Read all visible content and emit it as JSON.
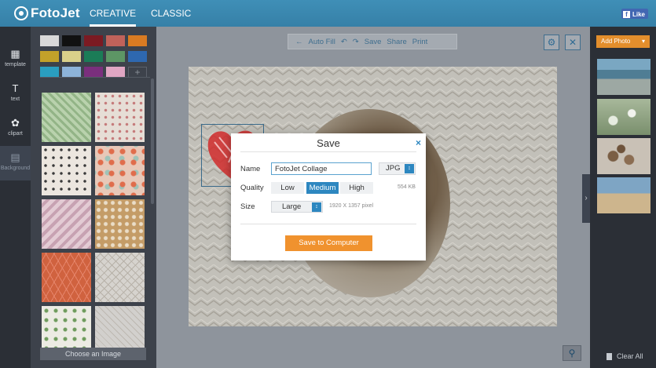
{
  "app": {
    "logo_text": "FotoJet",
    "nav": [
      {
        "label": "CREATIVE"
      },
      {
        "label": "CLASSIC"
      }
    ],
    "fb_like": "Like"
  },
  "rail": [
    {
      "label": "template",
      "icon": "template-icon"
    },
    {
      "label": "text",
      "icon": "text-icon"
    },
    {
      "label": "clipart",
      "icon": "clipart-icon"
    },
    {
      "label": "Background",
      "icon": "background-icon"
    }
  ],
  "panel": {
    "colors": [
      "#d9d9d9",
      "#111111",
      "#7b1a22",
      "#c0625a",
      "#d97b22",
      "#c2a12a",
      "#d9d08a",
      "#1b7c57",
      "#5d9665",
      "#2e68b0",
      "#2a9ec0",
      "#8db3d9",
      "#7a2f7d",
      "#e0a6c3"
    ],
    "add_label": "+",
    "choose_button": "Choose an Image"
  },
  "toolbar": {
    "back_icon": "←",
    "autofill": "Auto Fill",
    "undo": "↶",
    "redo": "↷",
    "save": "Save",
    "share": "Share",
    "print": "Print"
  },
  "right": {
    "add_photo": "Add Photo",
    "clear_all": "Clear All"
  },
  "dialog": {
    "title": "Save",
    "close": "×",
    "name_label": "Name",
    "name_value": "FotoJet Collage",
    "format_value": "JPG",
    "quality_label": "Quality",
    "quality_options": [
      "Low",
      "Medium",
      "High"
    ],
    "quality_selected": "Medium",
    "file_size": "554 KB",
    "size_label": "Size",
    "size_value": "Large",
    "dimensions": "1920 X 1357 pixel",
    "save_button": "Save to Computer"
  }
}
